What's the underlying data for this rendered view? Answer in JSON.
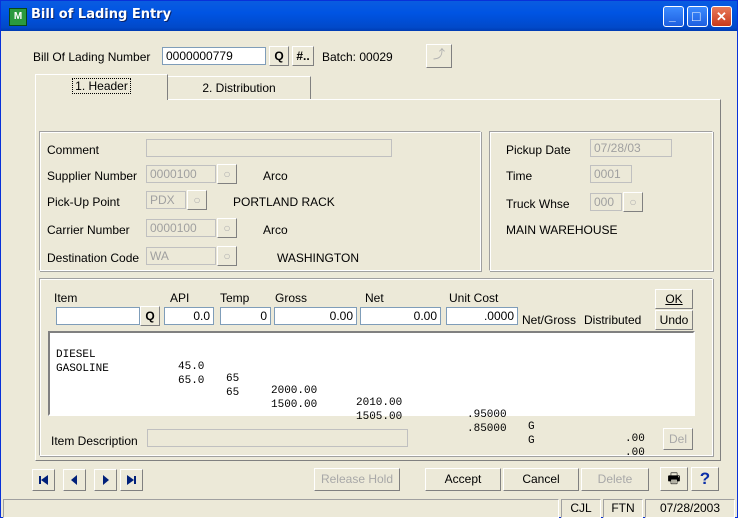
{
  "window": {
    "title": "Bill of Lading Entry",
    "icon_label": "M",
    "minimize_glyph": "_",
    "maximize_glyph": "□",
    "close_glyph": "✕"
  },
  "top": {
    "bol_label": "Bill Of Lading Number",
    "bol_value": "0000000779",
    "lookup_glyph": "Q",
    "next_number_label": "#..",
    "batch_label": "Batch: 00029"
  },
  "tabs": [
    {
      "label": "1. Header"
    },
    {
      "label": "2. Distribution"
    }
  ],
  "header_form": {
    "comment_label": "Comment",
    "comment_value": "",
    "supplier_label": "Supplier Number",
    "supplier_value": "0000100",
    "supplier_name": "Arco",
    "pickup_label": "Pick-Up Point",
    "pickup_value": "PDX",
    "pickup_name": "PORTLAND RACK",
    "carrier_label": "Carrier Number",
    "carrier_value": "0000100",
    "carrier_name": "Arco",
    "destination_label": "Destination Code",
    "destination_value": "WA",
    "destination_name": "WASHINGTON"
  },
  "pickup_panel": {
    "date_label": "Pickup Date",
    "date_value": "07/28/03",
    "time_label": "Time",
    "time_value": "0001",
    "whse_label": "Truck Whse",
    "whse_value": "000",
    "whse_name": "MAIN WAREHOUSE"
  },
  "line_entry": {
    "headers": {
      "item": "Item",
      "api": "API",
      "temp": "Temp",
      "gross": "Gross",
      "net": "Net",
      "unit_cost": "Unit Cost",
      "net_gross": "Net/Gross",
      "distributed": "Distributed"
    },
    "item_value": "",
    "api_value": "0.0",
    "temp_value": "0",
    "gross_value": "0.00",
    "net_value": "0.00",
    "unit_cost_value": ".0000",
    "ok_label": "OK",
    "undo_label": "Undo"
  },
  "lines": [
    {
      "item": "DIESEL",
      "api": "45.0",
      "temp": "65",
      "gross": "2000.00",
      "net": "2010.00",
      "unit_cost": ".95000",
      "net_gross": "G",
      "distributed": ".00"
    },
    {
      "item": "GASOLINE",
      "api": "65.0",
      "temp": "65",
      "gross": "1500.00",
      "net": "1505.00",
      "unit_cost": ".85000",
      "net_gross": "G",
      "distributed": ".00"
    }
  ],
  "item_description": {
    "label": "Item Description",
    "value": "",
    "del_label": "Del"
  },
  "buttons": {
    "release_hold": "Release Hold",
    "accept": "Accept",
    "cancel": "Cancel",
    "delete": "Delete",
    "print_glyph": "🖶",
    "help_glyph": "?"
  },
  "nav": {
    "first": "|◀",
    "prev": "◀",
    "next": "▶",
    "last": "▶|"
  },
  "status": {
    "user": "CJL",
    "company": "FTN",
    "date": "07/28/2003"
  }
}
